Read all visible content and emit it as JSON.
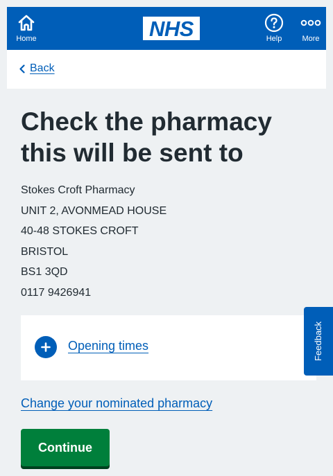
{
  "header": {
    "logo_text": "NHS",
    "home_label": "Home",
    "help_label": "Help",
    "more_label": "More"
  },
  "back": {
    "label": "Back"
  },
  "page": {
    "title": "Check the pharmacy this will be sent to"
  },
  "pharmacy": {
    "name": "Stokes Croft Pharmacy",
    "address_line_1": "UNIT 2, AVONMEAD HOUSE",
    "address_line_2": "40-48 STOKES CROFT",
    "town": "BRISTOL",
    "postcode": "BS1 3QD",
    "phone": "0117 9426941"
  },
  "opening_times": {
    "label": "Opening times"
  },
  "feedback": {
    "label": "Feedback"
  },
  "change_link": {
    "label": "Change your nominated pharmacy"
  },
  "continue_button": {
    "label": "Continue"
  },
  "colors": {
    "nhs_blue": "#005eb8",
    "button_green": "#007f3b",
    "page_background": "#eef1f3"
  }
}
